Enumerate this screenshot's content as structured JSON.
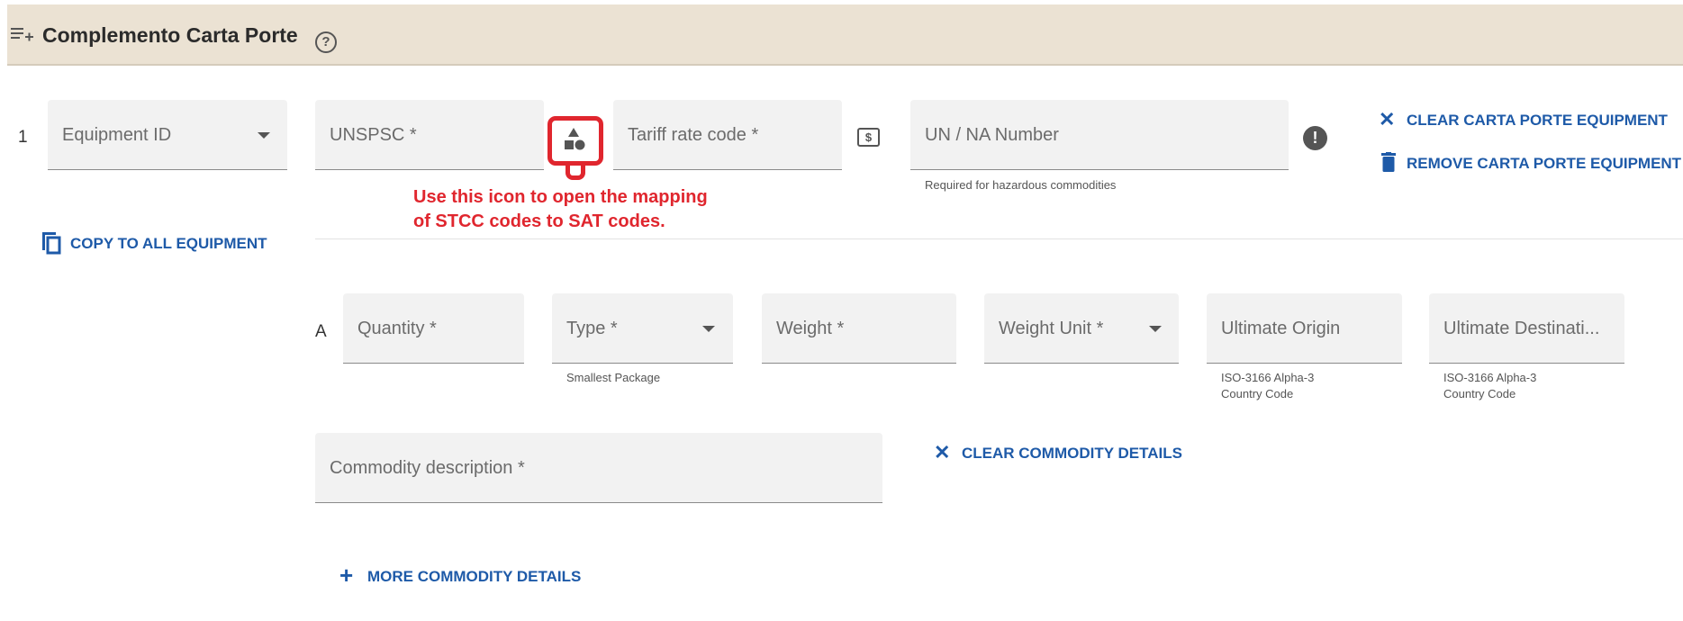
{
  "header": {
    "title": "Complemento Carta Porte",
    "help_icon": "?"
  },
  "equipment": {
    "row_number": "1",
    "equipment_id_label": "Equipment ID",
    "unspsc_label": "UNSPSC *",
    "tariff_label": "Tariff rate code *",
    "tariff_icon_text": "$",
    "un_na_label": "UN / NA Number",
    "un_na_hint": "Required for hazardous commodities",
    "copy_label": "COPY TO ALL EQUIPMENT",
    "clear_label": "CLEAR CARTA PORTE EQUIPMENT",
    "remove_label": "REMOVE CARTA PORTE EQUIPMENT"
  },
  "annotation": {
    "line1": "Use this icon to open the mapping",
    "line2": "of STCC codes to SAT codes.",
    "color": "#e0262e"
  },
  "commodity": {
    "row_letter": "A",
    "quantity_label": "Quantity *",
    "type_label": "Type *",
    "type_hint": "Smallest Package",
    "weight_label": "Weight *",
    "weight_unit_label": "Weight Unit *",
    "origin_label": "Ultimate Origin",
    "origin_hint_1": "ISO-3166 Alpha-3",
    "origin_hint_2": "Country Code",
    "destination_label": "Ultimate Destinati...",
    "destination_hint_1": "ISO-3166 Alpha-3",
    "destination_hint_2": "Country Code",
    "description_label": "Commodity description *",
    "clear_details_label": "CLEAR COMMODITY DETAILS",
    "more_details_label": "MORE COMMODITY DETAILS"
  },
  "colors": {
    "accent": "#1e5aa8",
    "header_bg": "#ebe2d3",
    "field_bg": "#f2f2f2",
    "annotation": "#e0262e"
  }
}
